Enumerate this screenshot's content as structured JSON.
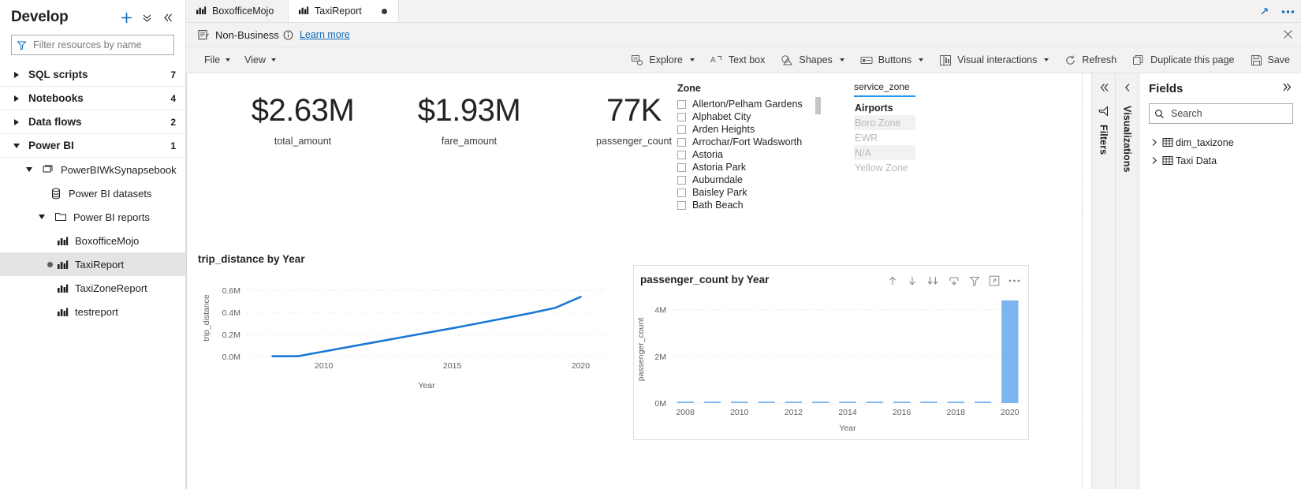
{
  "develop": {
    "title": "Develop",
    "actions": [
      {
        "name": "add-new-resource",
        "icon": "plus-icon"
      },
      {
        "name": "collapse-all",
        "icon": "chevron-double-down-icon"
      },
      {
        "name": "collapse-panel",
        "icon": "chevron-double-left-icon"
      }
    ],
    "filter": {
      "placeholder": "Filter resources by name",
      "value": ""
    },
    "tree": [
      {
        "label": "SQL scripts",
        "count": "7",
        "expanded": false
      },
      {
        "label": "Notebooks",
        "count": "4",
        "expanded": false
      },
      {
        "label": "Data flows",
        "count": "2",
        "expanded": false
      },
      {
        "label": "Power BI",
        "count": "1",
        "expanded": true
      }
    ],
    "workspace": {
      "label": "PowerBIWkSynapsebook",
      "expanded": true
    },
    "datasets": {
      "label": "Power BI datasets"
    },
    "reports_folder": {
      "label": "Power BI reports",
      "expanded": true
    },
    "reports": [
      {
        "label": "BoxofficeMojo",
        "selected": false,
        "dirty": false
      },
      {
        "label": "TaxiReport",
        "selected": true,
        "dirty": true
      },
      {
        "label": "TaxiZoneReport",
        "selected": false,
        "dirty": false
      },
      {
        "label": "testreport",
        "selected": false,
        "dirty": false
      }
    ]
  },
  "tabs": [
    {
      "label": "BoxofficeMojo",
      "active": false,
      "dirty": false
    },
    {
      "label": "TaxiReport",
      "active": true,
      "dirty": true
    }
  ],
  "tab_actions": [
    {
      "name": "expand-editor",
      "icon": "diagonal-arrow-icon"
    },
    {
      "name": "more-options",
      "icon": "ellipsis-icon"
    }
  ],
  "banner": {
    "label": "Non-Business",
    "icon": "sensitivity-label-icon",
    "info_icon": "info-circle-icon",
    "link": "Learn more",
    "close_icon": "close-icon"
  },
  "toolbar": {
    "menus": [
      {
        "label": "File",
        "name": "file-menu"
      },
      {
        "label": "View",
        "name": "view-menu"
      }
    ],
    "commands": [
      {
        "label": "Explore",
        "name": "explore-button",
        "icon": "explore-icon",
        "chevron": true
      },
      {
        "label": "Text box",
        "name": "text-box-button",
        "icon": "text-box-icon",
        "chevron": false
      },
      {
        "label": "Shapes",
        "name": "shapes-button",
        "icon": "shapes-icon",
        "chevron": true
      },
      {
        "label": "Buttons",
        "name": "buttons-button",
        "icon": "buttons-icon",
        "chevron": true
      },
      {
        "label": "Visual interactions",
        "name": "visual-interactions-button",
        "icon": "visual-interactions-icon",
        "chevron": true
      },
      {
        "label": "Refresh",
        "name": "refresh-button",
        "icon": "refresh-icon",
        "chevron": false
      },
      {
        "label": "Duplicate this page",
        "name": "duplicate-page-button",
        "icon": "duplicate-icon",
        "chevron": false
      },
      {
        "label": "Save",
        "name": "save-button",
        "icon": "save-icon",
        "chevron": false
      }
    ]
  },
  "report": {
    "kpis": [
      {
        "value": "$2.63M",
        "label": "total_amount"
      },
      {
        "value": "$1.93M",
        "label": "fare_amount"
      },
      {
        "value": "77K",
        "label": "passenger_count"
      }
    ],
    "zone_slicer": {
      "title": "Zone",
      "items": [
        {
          "label": "Allerton/Pelham Gardens",
          "checked": false
        },
        {
          "label": "Alphabet City",
          "checked": false
        },
        {
          "label": "Arden Heights",
          "checked": false
        },
        {
          "label": "Arrochar/Fort Wadsworth",
          "checked": false
        },
        {
          "label": "Astoria",
          "checked": false
        },
        {
          "label": "Astoria Park",
          "checked": false
        },
        {
          "label": "Auburndale",
          "checked": false
        },
        {
          "label": "Baisley Park",
          "checked": false
        },
        {
          "label": "Bath Beach",
          "checked": false
        }
      ]
    },
    "service_zone_slicer": {
      "title": "service_zone",
      "items": [
        {
          "label": "Airports",
          "state": "on",
          "shaded": false
        },
        {
          "label": "Boro Zone",
          "state": "off",
          "shaded": true
        },
        {
          "label": "EWR",
          "state": "off",
          "shaded": false
        },
        {
          "label": "N/A",
          "state": "off",
          "shaded": true
        },
        {
          "label": "Yellow Zone",
          "state": "off",
          "shaded": false
        }
      ]
    },
    "bar_visual_icons": [
      {
        "name": "drill-up-icon",
        "glyph": "up-arrow"
      },
      {
        "name": "drill-down-icon",
        "glyph": "down-arrow"
      },
      {
        "name": "expand-all-down-icon",
        "glyph": "double-down-arrow"
      },
      {
        "name": "go-to-next-level-icon",
        "glyph": "hierarchy-down"
      },
      {
        "name": "filter-icon",
        "glyph": "funnel"
      },
      {
        "name": "focus-mode-icon",
        "glyph": "focus"
      },
      {
        "name": "more-options-icon",
        "glyph": "ellipsis"
      }
    ]
  },
  "chart_data": [
    {
      "type": "line",
      "title": "trip_distance by Year",
      "xlabel": "Year",
      "ylabel": "trip_distance",
      "ylim": [
        0,
        700000
      ],
      "yticks": [
        0,
        200000,
        400000,
        600000
      ],
      "ytick_labels": [
        "0.0M",
        "0.2M",
        "0.4M",
        "0.6M"
      ],
      "xlim": [
        2007,
        2021
      ],
      "xticks": [
        2010,
        2015,
        2020
      ],
      "xtick_labels": [
        "2010",
        "2015",
        "2020"
      ],
      "grid": true,
      "legend": "none",
      "color": "#1a79d6",
      "x": [
        2008,
        2009,
        2010,
        2011,
        2012,
        2013,
        2014,
        2015,
        2016,
        2017,
        2018,
        2019,
        2020
      ],
      "values": [
        2000,
        3000,
        46000,
        88000,
        130000,
        172000,
        214000,
        256000,
        300000,
        345000,
        390000,
        440000,
        540000
      ]
    },
    {
      "type": "bar",
      "title": "passenger_count by Year",
      "xlabel": "Year",
      "ylabel": "passenger_count",
      "ylim": [
        0,
        4600000
      ],
      "yticks": [
        0,
        2000000,
        4000000
      ],
      "ytick_labels": [
        "0M",
        "2M",
        "4M"
      ],
      "xticks": [
        "2008",
        "2010",
        "2012",
        "2014",
        "2016",
        "2018",
        "2020"
      ],
      "grid": true,
      "legend": "none",
      "color": "#7cb5f0",
      "categories": [
        "2008",
        "2009",
        "2010",
        "2011",
        "2012",
        "2013",
        "2014",
        "2015",
        "2016",
        "2017",
        "2018",
        "2019",
        "2020"
      ],
      "values": [
        12000,
        14000,
        9000,
        8000,
        7000,
        7000,
        6000,
        6000,
        6000,
        5000,
        5000,
        5000,
        4400000
      ]
    }
  ],
  "right_rails": {
    "filters": {
      "label": "Filters",
      "collapse_icon": "chevron-double-left-icon",
      "filter_icon": "funnel-icon"
    },
    "visualizations": {
      "label": "Visualizations",
      "collapse_icon": "chevron-left-icon"
    }
  },
  "fields": {
    "title": "Fields",
    "expand_icon": "chevron-double-right-icon",
    "search": {
      "placeholder": "Search",
      "value": "",
      "icon": "search-icon"
    },
    "tables": [
      {
        "label": "dim_taxizone",
        "expanded": false
      },
      {
        "label": "Taxi Data",
        "expanded": false
      }
    ]
  }
}
